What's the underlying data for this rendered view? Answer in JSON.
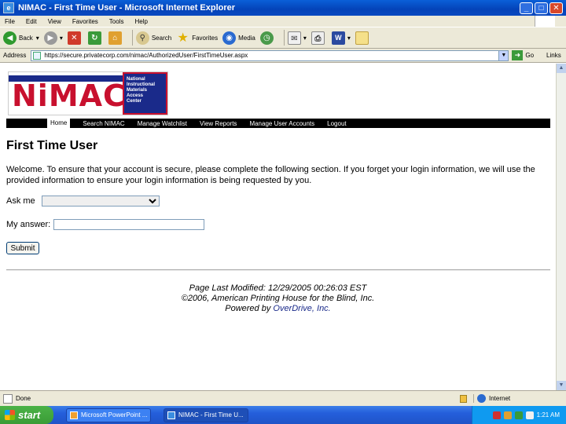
{
  "window": {
    "title": "NIMAC - First Time User - Microsoft Internet Explorer",
    "controls": [
      "_",
      "□",
      "✕"
    ]
  },
  "menu": [
    "File",
    "Edit",
    "View",
    "Favorites",
    "Tools",
    "Help"
  ],
  "toolbar": {
    "back_label": "Back",
    "search_label": "Search",
    "favorites_label": "Favorites",
    "media_label": "Media"
  },
  "address": {
    "label": "Address",
    "url": "https://secure.privatecorp.com/nimac/AuthorizedUser/FirstTimeUser.aspx",
    "go_label": "Go",
    "links_label": "Links"
  },
  "site": {
    "logo_word": "NiMAC",
    "logo_full": [
      "National",
      "Instructional",
      "Materials",
      "Access",
      "Center"
    ],
    "nav": [
      "Home",
      "Search NIMAC",
      "Manage Watchlist",
      "View Reports",
      "Manage User Accounts",
      "Logout"
    ]
  },
  "content": {
    "heading": "First Time User",
    "welcome": "Welcome. To ensure that your account is secure, please complete the following section. If you forget your login information, we will use the provided information to ensure your login information is being requested by you.",
    "ask_label": "Ask me",
    "answer_label": "My answer:",
    "submit_label": "Submit"
  },
  "footer": {
    "modified": "Page Last Modified: 12/29/2005 00:26:03 EST",
    "copyright": "©2006, American Printing House for the Blind, Inc.",
    "powered_prefix": "Powered by ",
    "powered_link": "OverDrive, Inc."
  },
  "status": {
    "text": "Done",
    "zone": "Internet"
  },
  "taskbar": {
    "start_label": "start",
    "tasks": [
      "Microsoft PowerPoint ...",
      "NIMAC - First Time U..."
    ],
    "clock": "1:21 AM"
  }
}
